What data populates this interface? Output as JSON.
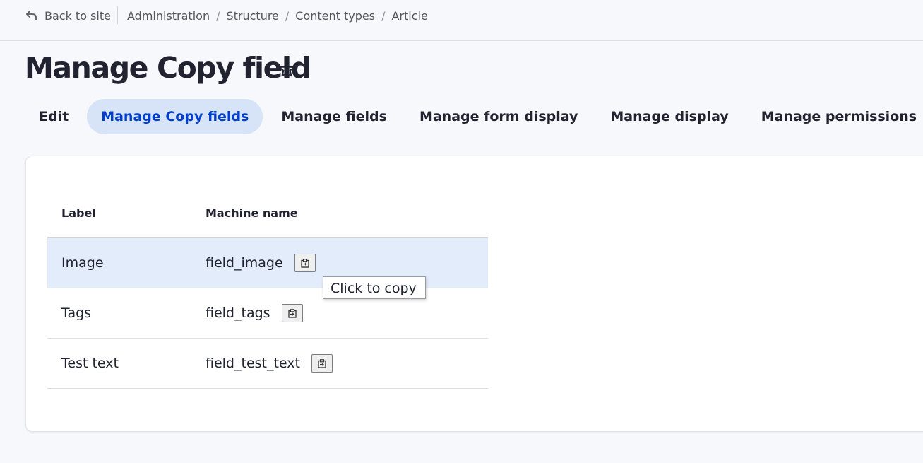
{
  "header": {
    "back_label": "Back to site",
    "breadcrumbs": [
      "Administration",
      "Structure",
      "Content types",
      "Article"
    ]
  },
  "page": {
    "title": "Manage Copy field"
  },
  "tabs": [
    {
      "label": "Edit",
      "active": false
    },
    {
      "label": "Manage Copy fields",
      "active": true
    },
    {
      "label": "Manage fields",
      "active": false
    },
    {
      "label": "Manage form display",
      "active": false
    },
    {
      "label": "Manage display",
      "active": false
    },
    {
      "label": "Manage permissions",
      "active": false
    }
  ],
  "table": {
    "columns": [
      "Label",
      "Machine name"
    ],
    "rows": [
      {
        "label": "Image",
        "machine_name": "field_image",
        "highlighted": true
      },
      {
        "label": "Tags",
        "machine_name": "field_tags",
        "highlighted": false
      },
      {
        "label": "Test text",
        "machine_name": "field_test_text",
        "highlighted": false
      }
    ]
  },
  "tooltip": {
    "text": "Click to copy"
  },
  "colors": {
    "accent": "#003ecc",
    "active_tab_bg": "#d7e4f8",
    "highlight_row_bg": "#e3ecfb",
    "page_bg": "#f7f8fc"
  },
  "icons": {
    "back": "back-arrow-icon",
    "favorite": "star-icon",
    "copy": "clipboard-icon"
  }
}
